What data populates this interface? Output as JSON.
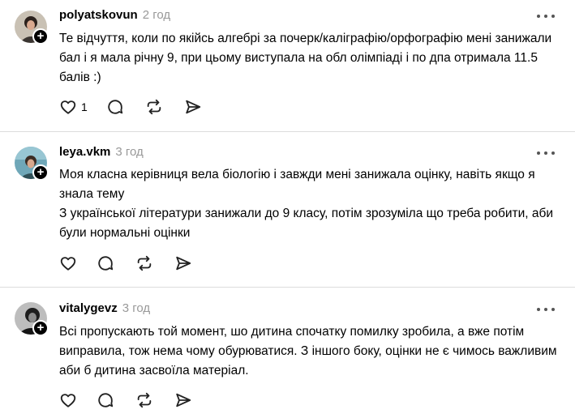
{
  "posts": [
    {
      "username": "polyatskovun",
      "time": "2 год",
      "avatar": "avatar-photo",
      "text": [
        "Те відчуття, коли по якійсь алгебрі за почерк/каліграфію/орфографію мені занижали бал і я мала річну 9, при цьому виступала на обл олімпіаді і по дпа отримала 11.5 балів :)"
      ],
      "likes": "1"
    },
    {
      "username": "leya.vkm",
      "time": "3 год",
      "avatar": "avatar-photo",
      "text": [
        "Моя класна керівниця вела біологію і завжди мені занижала оцінку, навіть якщо я знала тему",
        "З української літератури занижали до 9 класу, потім зрозуміла що треба робити, аби були нормальні оцінки"
      ],
      "likes": ""
    },
    {
      "username": "vitalygevz",
      "time": "3 год",
      "avatar": "avatar-photo",
      "text": [
        "Всі пропускають той момент, шо дитина спочатку помилку зробила, а вже потім виправила, тож нема чому обурюватися. З іншого боку, оцінки не є чимось важливим аби б дитина засвоїла матеріал."
      ],
      "likes": ""
    }
  ],
  "icons": {
    "like": "heart-icon",
    "reply": "comment-icon",
    "repost": "repost-icon",
    "share": "send-icon",
    "more": "more-icon",
    "follow": "plus-icon"
  },
  "colors": {
    "muted": "#999999",
    "divider": "#dcdcdc",
    "text": "#000000"
  }
}
